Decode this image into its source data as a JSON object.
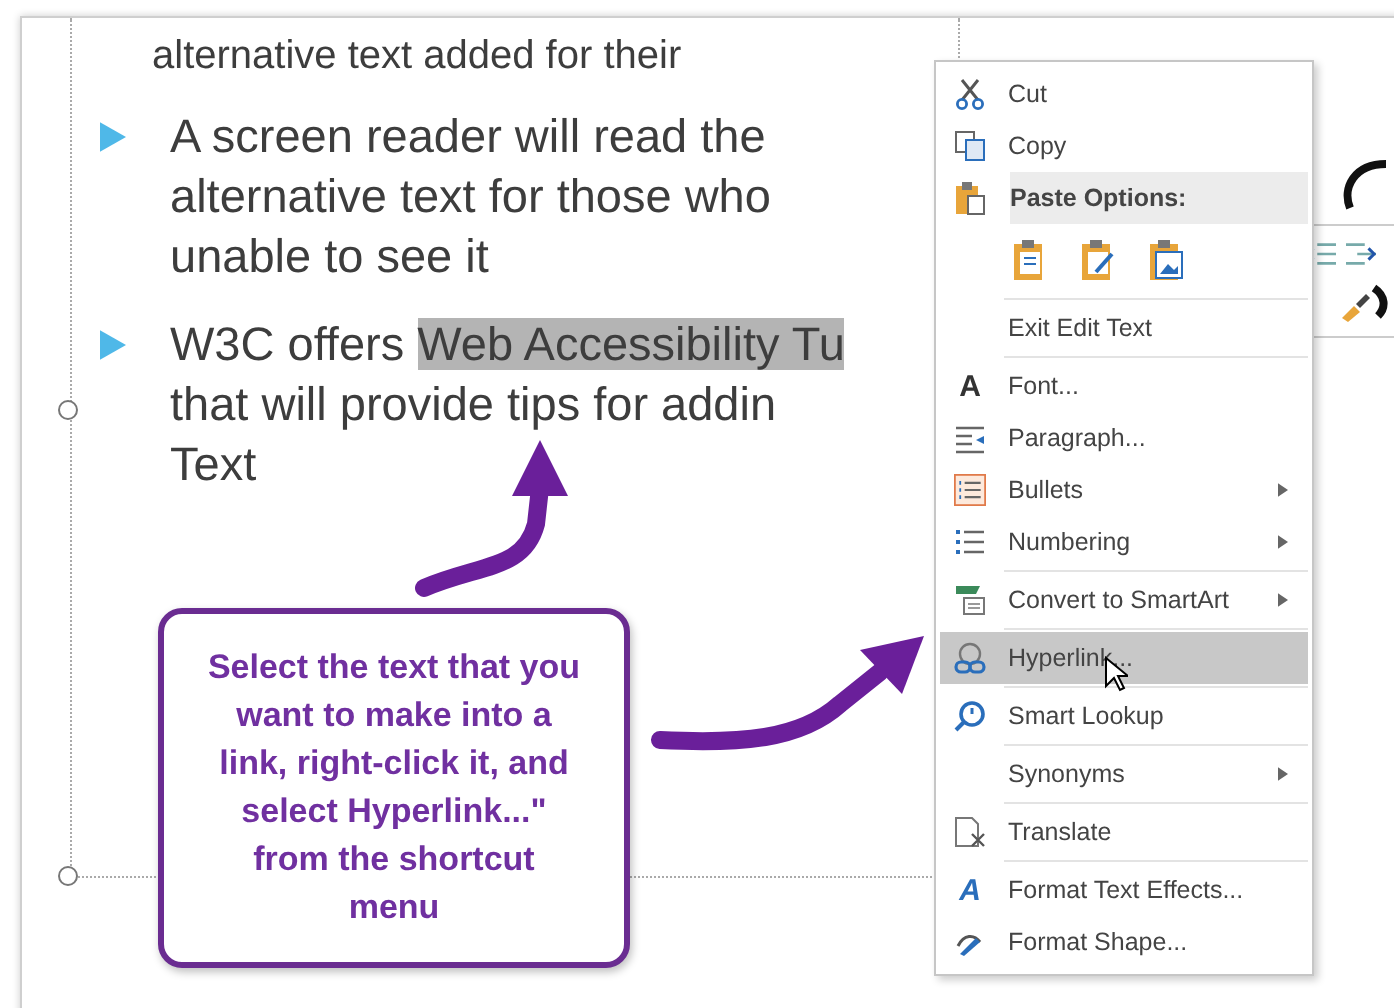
{
  "slide": {
    "top_line": "alternative text added for their",
    "bullets": [
      {
        "lines": [
          {
            "text": "A screen reader will read the"
          },
          {
            "text": "alternative text for those who"
          },
          {
            "text": "unable to see it"
          }
        ]
      },
      {
        "lines": [
          {
            "text": "W3C offers ",
            "highlight": "Web Accessibility Tu"
          },
          {
            "text": "that will provide tips for addin"
          },
          {
            "text": "Text"
          }
        ]
      }
    ]
  },
  "callout": {
    "text": "Select the text that you want to make into a link, right-click it, and select Hyperlink...\" from the shortcut menu"
  },
  "context_menu": {
    "items": [
      {
        "kind": "item",
        "label": "Cut",
        "selected": false
      },
      {
        "kind": "item",
        "label": "Copy",
        "selected": false
      },
      {
        "kind": "header",
        "label": "Paste Options:"
      },
      {
        "kind": "paste-icons"
      },
      {
        "kind": "separator"
      },
      {
        "kind": "item",
        "label": "Exit Edit Text",
        "selected": false
      },
      {
        "kind": "separator"
      },
      {
        "kind": "item",
        "label": "Font...",
        "glyph": "A",
        "selected": false
      },
      {
        "kind": "item",
        "label": "Paragraph...",
        "selected": false
      },
      {
        "kind": "item",
        "label": "Bullets",
        "submenu": true,
        "selected": false
      },
      {
        "kind": "item",
        "label": "Numbering",
        "submenu": true,
        "selected": false
      },
      {
        "kind": "separator"
      },
      {
        "kind": "item",
        "label": "Convert to SmartArt",
        "submenu": true,
        "selected": false
      },
      {
        "kind": "separator"
      },
      {
        "kind": "item",
        "label": "Hyperlink...",
        "selected": true
      },
      {
        "kind": "separator"
      },
      {
        "kind": "item",
        "label": "Smart Lookup",
        "selected": false
      },
      {
        "kind": "separator"
      },
      {
        "kind": "item",
        "label": "Synonyms",
        "submenu": true,
        "selected": false
      },
      {
        "kind": "separator"
      },
      {
        "kind": "item",
        "label": "Translate",
        "selected": false
      },
      {
        "kind": "separator"
      },
      {
        "kind": "item",
        "label": "Format Text Effects...",
        "glyph": "A",
        "selected": false
      },
      {
        "kind": "item",
        "label": "Format Shape...",
        "selected": false
      }
    ]
  }
}
